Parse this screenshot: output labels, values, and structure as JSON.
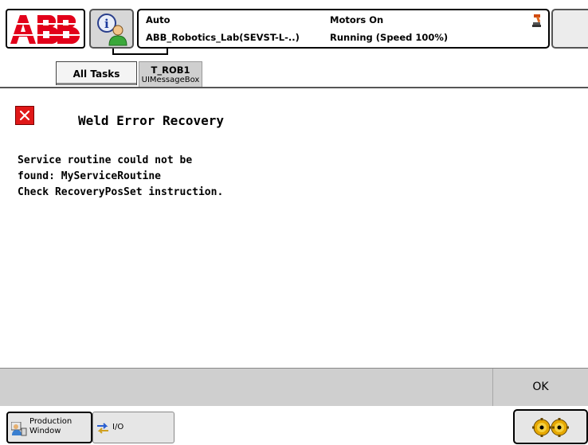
{
  "header": {
    "logo_text": "ABB",
    "operating_mode": "Auto",
    "system_name": "ABB_Robotics_Lab(SEVST-L-..)",
    "motors_state": "Motors On",
    "program_state": "Running (Speed 100%)",
    "icons": [
      "abb-logo",
      "info-user-icon",
      "robot-status-icon"
    ]
  },
  "tasks": {
    "all_tasks_label": "All Tasks",
    "active_task": {
      "name": "T_ROB1",
      "subtitle": "UIMessageBox"
    }
  },
  "message": {
    "icon": "error-icon",
    "title": "Weld Error Recovery",
    "body_lines": [
      "Service routine could not be",
      "found: MyServiceRoutine",
      "Check RecoveryPosSet instruction."
    ]
  },
  "command_bar": {
    "ok_label": "OK"
  },
  "taskbar": {
    "production_label_line1": "Production",
    "production_label_line2": "Window",
    "io_label": "I/O",
    "icons": [
      "production-window-icon",
      "io-arrows-icon",
      "quickset-gears-icon"
    ]
  },
  "colors": {
    "abb_red": "#e2001a",
    "error_red": "#e01818",
    "command_bar_gray": "#cfcfcf"
  }
}
